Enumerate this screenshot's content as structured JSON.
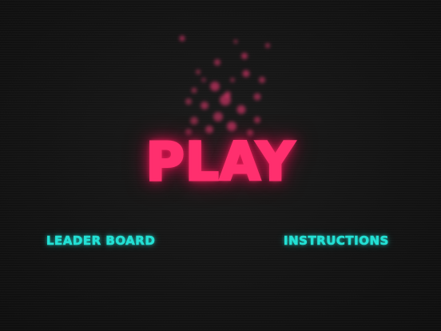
{
  "menu": {
    "play_label": "PLAY",
    "leaderboard_label": "LEADER BOARD",
    "instructions_label": "INSTRUCTIONS"
  },
  "colors": {
    "background": "#121212",
    "play": "#ff2f6e",
    "links": "#23e0d4",
    "particles": "#ff3d7a"
  }
}
